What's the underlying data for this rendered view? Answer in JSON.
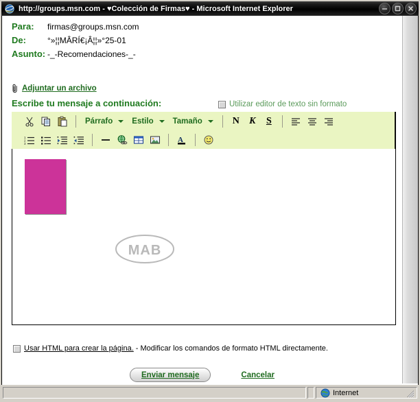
{
  "window": {
    "title": "http://groups.msn.com - ♥Colección de Firmas♥ - Microsoft Internet Explorer",
    "icon": "internet-explorer-icon",
    "minimize_label": "–",
    "maximize_label": "□",
    "close_label": "×"
  },
  "form": {
    "fields": [
      {
        "label": "Para:",
        "value": "firmas@groups.msn.com"
      },
      {
        "label": "De:",
        "value": "°»¦¦MÂRÍ€¡Â¦¦»°25-01"
      },
      {
        "label": "Asunto:",
        "value": "-_-Recomendaciones-_-"
      }
    ],
    "attach_link": "Adjuntar un archivo",
    "attach_icon": "paperclip-icon",
    "prompt": "Escribe tu mensaje a continuación:",
    "plaintext_checkbox_label": "Utilizar editor de texto sin formato",
    "plaintext_checked": false
  },
  "toolbar": {
    "row1": [
      {
        "name": "cut",
        "icon": "scissors-icon",
        "type": "icon"
      },
      {
        "name": "copy",
        "icon": "copy-icon",
        "type": "icon"
      },
      {
        "name": "paste",
        "icon": "paste-icon",
        "type": "icon"
      },
      {
        "name": "paragraph",
        "label": "Párrafo",
        "type": "dropdown"
      },
      {
        "name": "style",
        "label": "Estilo",
        "type": "dropdown"
      },
      {
        "name": "size",
        "label": "Tamaño",
        "type": "dropdown"
      },
      {
        "name": "bold",
        "label": "N",
        "type": "format"
      },
      {
        "name": "italic",
        "label": "K",
        "type": "format"
      },
      {
        "name": "underline",
        "label": "S",
        "type": "format"
      },
      {
        "name": "align-left",
        "icon": "align-left-icon",
        "type": "icon"
      },
      {
        "name": "align-center",
        "icon": "align-center-icon",
        "type": "icon"
      },
      {
        "name": "align-right",
        "icon": "align-right-icon",
        "type": "icon"
      }
    ],
    "row2": [
      {
        "name": "numbered-list",
        "icon": "numbered-list-icon"
      },
      {
        "name": "bulleted-list",
        "icon": "bulleted-list-icon"
      },
      {
        "name": "decrease-indent",
        "icon": "decrease-indent-icon"
      },
      {
        "name": "increase-indent",
        "icon": "increase-indent-icon"
      },
      {
        "name": "horizontal-rule",
        "icon": "horizontal-rule-icon"
      },
      {
        "name": "insert-link",
        "icon": "globe-link-icon"
      },
      {
        "name": "insert-table",
        "icon": "table-icon"
      },
      {
        "name": "insert-image",
        "icon": "image-icon"
      },
      {
        "name": "font-color",
        "icon": "font-color-icon"
      },
      {
        "name": "insert-emoticon",
        "icon": "smiley-icon"
      }
    ]
  },
  "editor": {
    "image_block_color": "#cc3399",
    "watermark_text": "MAB"
  },
  "html_option": {
    "checked": false,
    "link": "Usar HTML para crear la página.",
    "description": "- Modificar los comandos de formato HTML directamente."
  },
  "actions": {
    "send_label": "Enviar mensaje",
    "cancel_label": "Cancelar"
  },
  "statusbar": {
    "zone_label": "Internet",
    "zone_icon": "globe-icon"
  }
}
